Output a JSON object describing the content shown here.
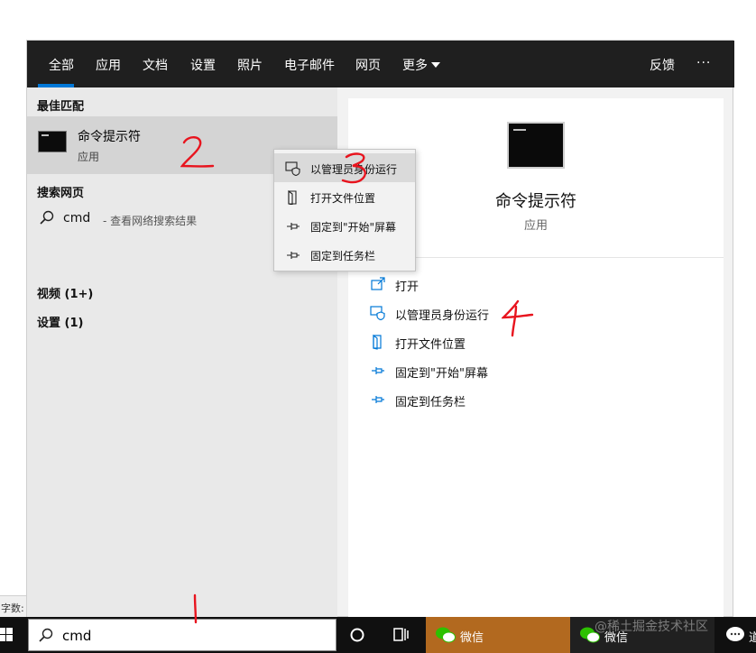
{
  "nav": {
    "tabs": [
      "全部",
      "应用",
      "文档",
      "设置",
      "照片",
      "电子邮件",
      "网页",
      "更多"
    ],
    "feedback": "反馈",
    "more_dots": "···"
  },
  "left": {
    "best_match_heading": "最佳匹配",
    "best_match_title": "命令提示符",
    "best_match_type": "应用",
    "web_heading": "搜索网页",
    "web_query": "cmd",
    "web_hint": "- 查看网络搜索结果",
    "video_heading": "视频 (1+)",
    "settings_heading": "设置 (1)"
  },
  "context_menu": [
    {
      "label": "以管理员身份运行",
      "icon": "shield-icon"
    },
    {
      "label": "打开文件位置",
      "icon": "file-location-icon"
    },
    {
      "label": "固定到\"开始\"屏幕",
      "icon": "pin-icon"
    },
    {
      "label": "固定到任务栏",
      "icon": "pin-icon"
    }
  ],
  "right": {
    "app_title": "命令提示符",
    "app_type": "应用",
    "actions": [
      {
        "label": "打开",
        "icon": "open-icon"
      },
      {
        "label": "以管理员身份运行",
        "icon": "shield-icon"
      },
      {
        "label": "打开文件位置",
        "icon": "file-location-icon"
      },
      {
        "label": "固定到\"开始\"屏幕",
        "icon": "pin-icon"
      },
      {
        "label": "固定到任务栏",
        "icon": "pin-icon"
      }
    ]
  },
  "taskbar": {
    "search_text": "cmd",
    "wechat_label_1": "微信",
    "wechat_label_2": "微信",
    "truncated_label": "道"
  },
  "background": {
    "word_count_label": "字数:"
  },
  "watermark": "@稀土掘金技术社区",
  "annotations": [
    "1",
    "2",
    "3",
    "4"
  ],
  "colors": {
    "accent": "#0078d7",
    "nav_bg": "#1f1f1f",
    "annotation": "#e8141e",
    "wechat_active": "#b2691f",
    "wechat_green": "#2dc100"
  }
}
